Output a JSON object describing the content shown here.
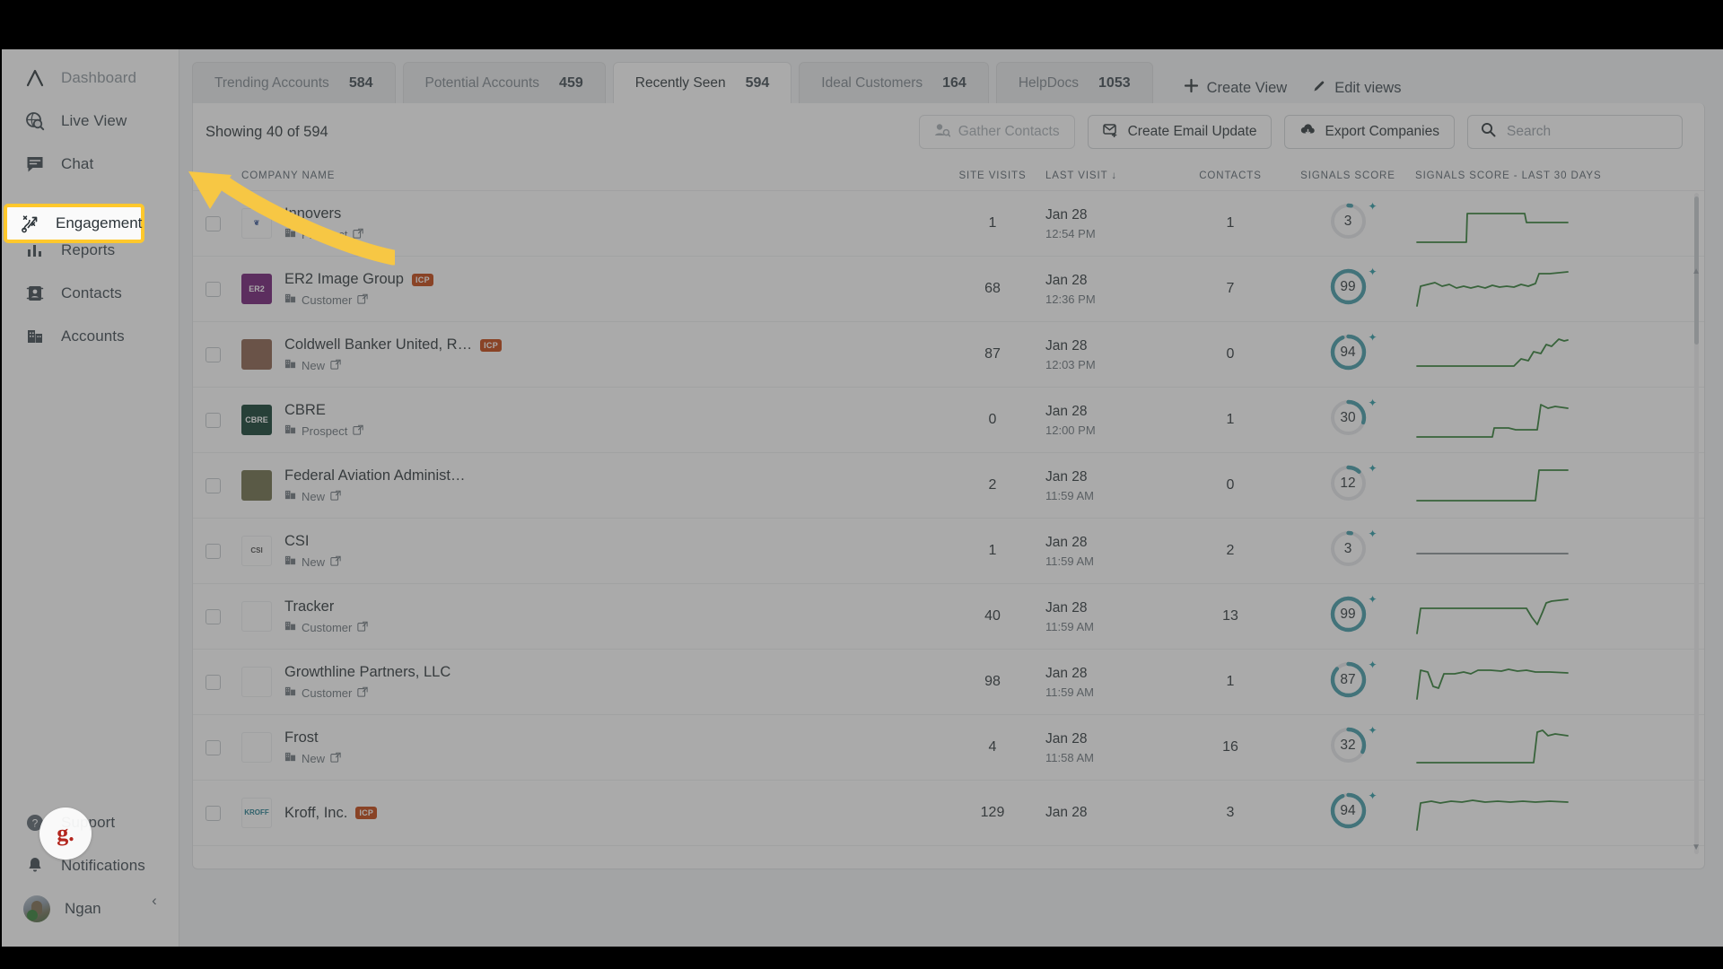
{
  "sidebar": {
    "items": [
      {
        "label": "Dashboard",
        "icon": "logo-a-icon",
        "active": false
      },
      {
        "label": "Live View",
        "icon": "globe-search-icon",
        "active": false
      },
      {
        "label": "Chat",
        "icon": "chat-bubble-icon",
        "active": false
      },
      {
        "label": "Engagement",
        "icon": "engagement-strategy-icon",
        "active": true
      },
      {
        "label": "Reports",
        "icon": "bar-chart-icon",
        "active": false
      },
      {
        "label": "Contacts",
        "icon": "contact-card-icon",
        "active": false
      },
      {
        "label": "Accounts",
        "icon": "accounts-building-icon",
        "active": false
      }
    ],
    "bottom_items": [
      {
        "label": "Support",
        "icon": "question-circle-icon"
      },
      {
        "label": "Notifications",
        "icon": "bell-icon"
      }
    ],
    "user": {
      "name": "Ngan",
      "avatar": "user-avatar"
    },
    "collapse_label": "‹",
    "cursor_label": "g."
  },
  "tabs": [
    {
      "label": "Trending Accounts",
      "count": "584",
      "active": false
    },
    {
      "label": "Potential Accounts",
      "count": "459",
      "active": false
    },
    {
      "label": "Recently Seen",
      "count": "594",
      "active": true
    },
    {
      "label": "Ideal Customers",
      "count": "164",
      "active": false
    },
    {
      "label": "HelpDocs",
      "count": "1053",
      "active": false
    }
  ],
  "view_buttons": [
    {
      "label": "Create View",
      "icon": "plus-icon"
    },
    {
      "label": "Edit views",
      "icon": "pencil-icon"
    }
  ],
  "toolbar": {
    "showing_text": "Showing 40 of  594",
    "gather_contacts": "Gather Contacts",
    "create_email_update": "Create Email Update",
    "export_companies": "Export Companies",
    "search_placeholder": "Search",
    "search_value": ""
  },
  "table": {
    "columns": [
      "COMPANY NAME",
      "SITE VISITS",
      "LAST VISIT",
      "CONTACTS",
      "SIGNALS SCORE",
      "SIGNALS SCORE - LAST 30 DAYS"
    ],
    "sort_indicator": "↓",
    "rows": [
      {
        "name": "Innovers",
        "icp": false,
        "status": "Prospect",
        "visits": "1",
        "date": "Jan 28",
        "time": "12:54 PM",
        "contacts": "1",
        "score": 3,
        "logo": {
          "text": "❦",
          "bg": "#ffffff",
          "fg": "#3b5a9a"
        },
        "spark": "2,46 44,46 46,46 57,46 58,14 80,14 104,14 118,14 122,14 124,24 150,24 170,24"
      },
      {
        "name": "ER2 Image Group",
        "icp": true,
        "status": "Customer",
        "visits": "68",
        "date": "Jan 28",
        "time": "12:36 PM",
        "contacts": "7",
        "score": 99,
        "logo": {
          "text": "ER2",
          "bg": "#701a75",
          "fg": "#ffffff"
        },
        "spark": "2,44 6,22 14,20 22,18 30,22 38,20 46,24 54,22 62,24 70,22 78,24 86,21 94,23 102,22 110,23 118,20 126,22 134,19 138,8 150,8 170,6"
      },
      {
        "name": "Coldwell Banker United, R…",
        "icp": true,
        "status": "New",
        "visits": "87",
        "date": "Jan 28",
        "time": "12:03 PM",
        "contacts": "0",
        "score": 94,
        "logo": {
          "text": "",
          "bg": "#8a5f4a",
          "fg": "#ffffff"
        },
        "spark": "2,38 30,38 60,38 90,38 110,38 118,30 126,32 132,22 140,24 146,14 152,16 160,8 166,10 170,9"
      },
      {
        "name": "CBRE",
        "icp": false,
        "status": "Prospect",
        "visits": "0",
        "date": "Jan 28",
        "time": "12:00 PM",
        "contacts": "1",
        "score": 30,
        "logo": {
          "text": "CBRE",
          "bg": "#0d3b2e",
          "fg": "#ffffff"
        },
        "spark": "2,44 40,44 70,44 86,44 88,34 104,34 112,36 130,36 136,36 140,8 148,12 156,10 170,12"
      },
      {
        "name": "Federal Aviation Administ…",
        "icp": false,
        "status": "New",
        "visits": "2",
        "date": "Jan 28",
        "time": "11:59 AM",
        "contacts": "0",
        "score": 12,
        "logo": {
          "text": "",
          "bg": "#6b6b47",
          "fg": "#ffffff"
        },
        "spark": "2,42 40,42 80,42 110,42 134,42 138,8 150,8 170,8"
      },
      {
        "name": "CSI",
        "icp": false,
        "status": "New",
        "visits": "1",
        "date": "Jan 28",
        "time": "11:59 AM",
        "contacts": "2",
        "score": 3,
        "logo": {
          "text": "CSI",
          "bg": "#ffffff",
          "fg": "#4a4a4a"
        },
        "flat": true,
        "spark": "2,28 170,28"
      },
      {
        "name": "Tracker",
        "icp": false,
        "status": "Customer",
        "visits": "40",
        "date": "Jan 28",
        "time": "11:59 AM",
        "contacts": "13",
        "score": 99,
        "logo": {
          "text": "",
          "bg": "#ffffff",
          "fg": "#c0392b"
        },
        "spark": "2,44 6,16 40,16 80,16 110,16 124,16 130,26 136,34 142,20 146,10 152,8 170,6"
      },
      {
        "name": "Growthline Partners, LLC",
        "icp": false,
        "status": "Customer",
        "visits": "98",
        "date": "Jan 28",
        "time": "11:59 AM",
        "contacts": "1",
        "score": 87,
        "logo": {
          "text": "",
          "bg": "#ffffff",
          "fg": "#b03a2e"
        },
        "spark": "2,44 6,12 14,14 20,30 26,32 32,16 44,16 54,14 62,16 70,12 84,12 96,13 104,11 114,13 124,12 134,14 150,14 170,15"
      },
      {
        "name": "Frost",
        "icp": false,
        "status": "New",
        "visits": "4",
        "date": "Jan 28",
        "time": "11:58 AM",
        "contacts": "16",
        "score": 32,
        "logo": {
          "text": "",
          "bg": "#ffffff",
          "fg": "#14365c"
        },
        "spark": "2,42 40,42 80,42 110,42 132,42 136,8 142,6 148,12 156,10 170,12"
      },
      {
        "name": "Kroff, Inc.",
        "icp": true,
        "status": "",
        "visits": "129",
        "date": "Jan 28",
        "time": "",
        "contacts": "3",
        "score": 94,
        "logo": {
          "text": "KROFF",
          "bg": "#ffffff",
          "fg": "#1f7a8c"
        },
        "spark": "2,44 6,14 18,12 28,14 40,12 52,13 64,11 78,13 92,12 106,13 120,12 134,13 150,12 170,13"
      }
    ]
  },
  "colors": {
    "accent_teal": "#3f9aa6",
    "spark_green": "#2e7d32",
    "icp_badge": "#c2410c",
    "highlight_yellow": "#ffc82c",
    "arrow_yellow": "#f7c744"
  }
}
